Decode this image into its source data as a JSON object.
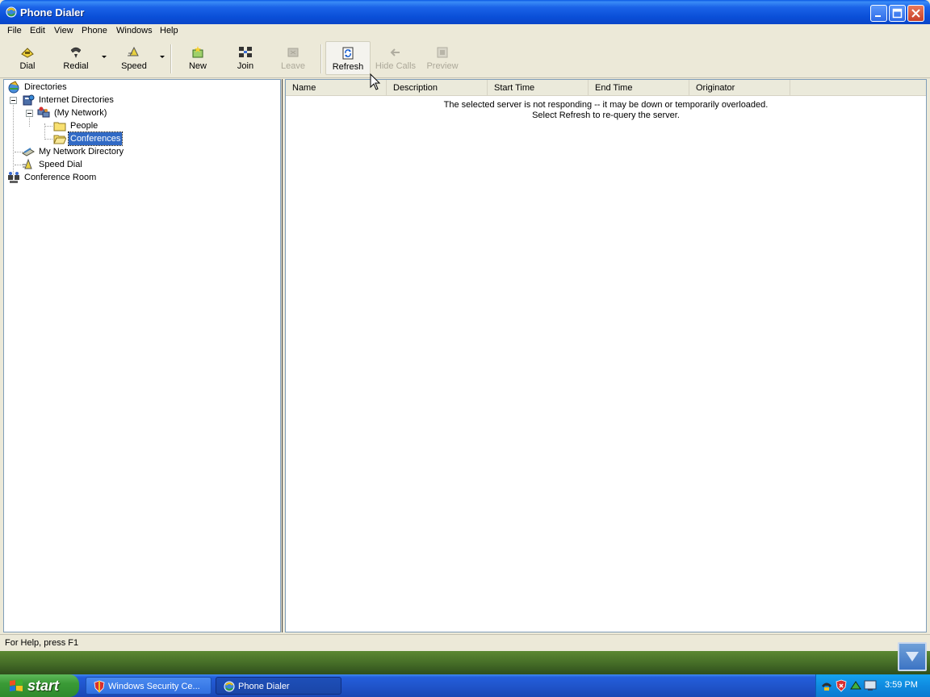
{
  "window": {
    "title": "Phone Dialer"
  },
  "menu": [
    "File",
    "Edit",
    "View",
    "Phone",
    "Windows",
    "Help"
  ],
  "toolbar": {
    "dial": "Dial",
    "redial": "Redial",
    "speed": "Speed",
    "new": "New",
    "join": "Join",
    "leave": "Leave",
    "refresh": "Refresh",
    "hide_calls": "Hide Calls",
    "preview": "Preview"
  },
  "tree": {
    "directories": "Directories",
    "internet_directories": "Internet Directories",
    "my_network": "(My Network)",
    "people": "People",
    "conferences": "Conferences",
    "my_network_directory": "My Network Directory",
    "speed_dial": "Speed Dial",
    "conference_room": "Conference Room"
  },
  "list": {
    "columns": [
      "Name",
      "Description",
      "Start Time",
      "End Time",
      "Originator"
    ],
    "message_line1": "The selected server is not responding -- it may be down or temporarily overloaded.",
    "message_line2": "Select Refresh to re-query the server."
  },
  "status": {
    "text": "For Help, press F1"
  },
  "taskbar": {
    "start": "start",
    "tasks": [
      "Windows Security Ce...",
      "Phone Dialer"
    ],
    "clock": "3:59 PM"
  }
}
